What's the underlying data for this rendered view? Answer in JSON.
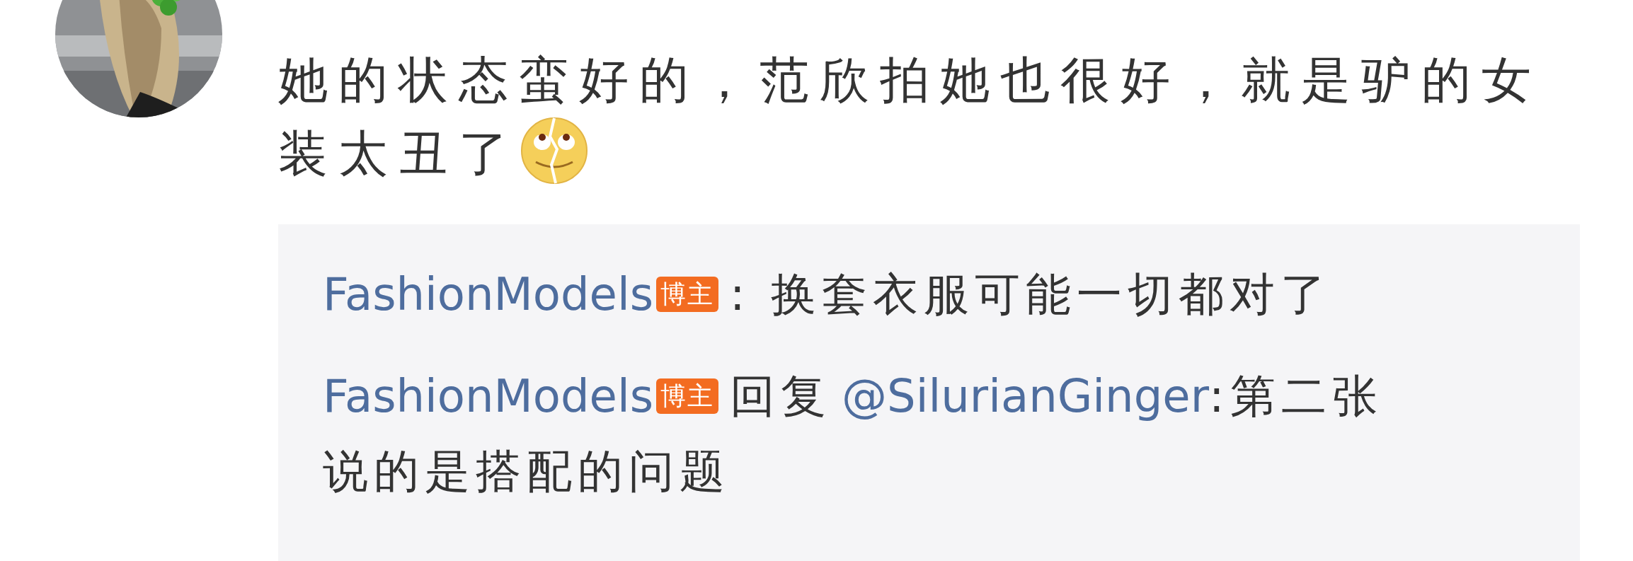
{
  "comment": {
    "lines": [
      "她的状态蛮好的，范欣拍她也很好，就是驴的女",
      "装太丑了"
    ],
    "replies": [
      {
        "author": "FashionModels",
        "badge": "博主",
        "lines": [
          ": 换套衣服可能一切都对了"
        ]
      },
      {
        "author": "FashionModels",
        "badge": "博主",
        "prefix": "回复",
        "mention": "@SilurianGinger",
        "lines": [
          ":第二张",
          "说的是搭配的问题"
        ]
      }
    ]
  }
}
